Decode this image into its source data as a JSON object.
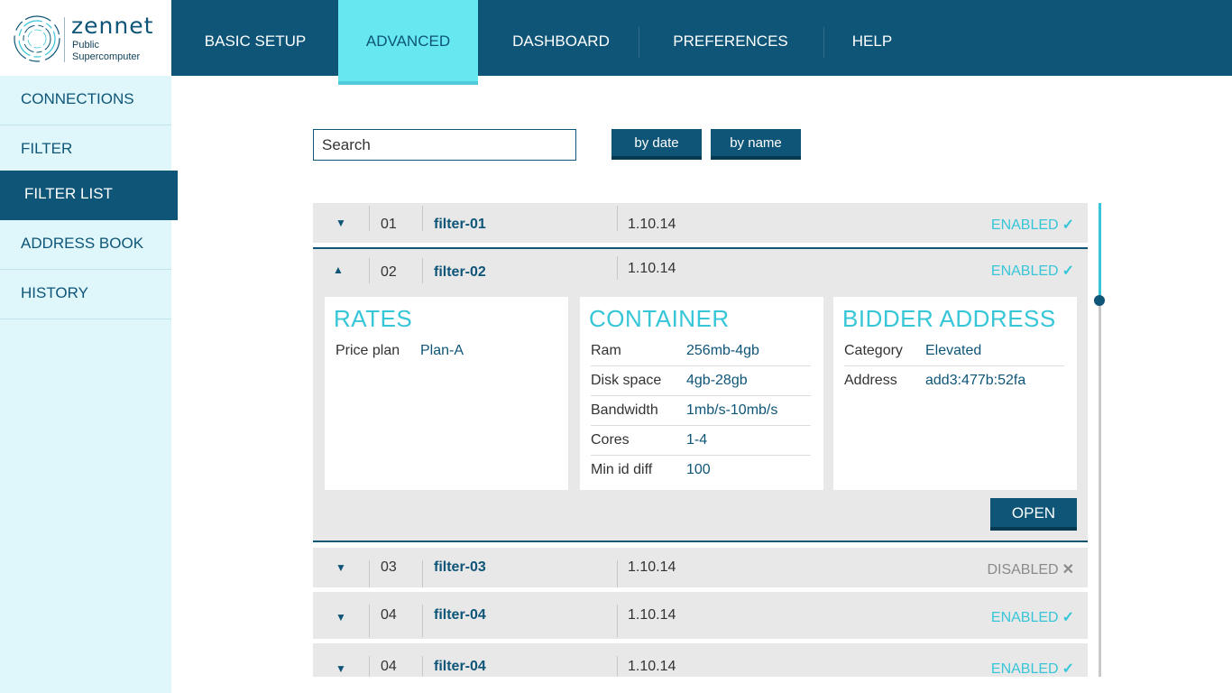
{
  "logo": {
    "brand": "zennet",
    "sub_line1": "Public",
    "sub_line2": "Supercomputer"
  },
  "nav": {
    "tabs": [
      {
        "label": "BASIC SETUP"
      },
      {
        "label": "ADVANCED"
      },
      {
        "label": "DASHBOARD"
      },
      {
        "label": "PREFERENCES"
      },
      {
        "label": "HELP"
      }
    ],
    "active_tab": "ADVANCED"
  },
  "sidebar": {
    "items": [
      {
        "label": "CONNECTIONS"
      },
      {
        "label": "FILTER"
      },
      {
        "label": "FILTER LIST"
      },
      {
        "label": "ADDRESS BOOK"
      },
      {
        "label": "HISTORY"
      }
    ],
    "active_item": "FILTER LIST"
  },
  "search": {
    "placeholder": "Search",
    "value": ""
  },
  "sort": {
    "by_date": "by date",
    "by_name": "by name"
  },
  "filters": [
    {
      "num": "01",
      "name": "filter-01",
      "date": "1.10.14",
      "status": "ENABLED",
      "mark": "✓",
      "expanded": false
    },
    {
      "num": "02",
      "name": "filter-02",
      "date": "1.10.14",
      "status": "ENABLED",
      "mark": "✓",
      "expanded": true
    },
    {
      "num": "03",
      "name": "filter-03",
      "date": "1.10.14",
      "status": "DISABLED",
      "mark": "✕",
      "expanded": false
    },
    {
      "num": "04",
      "name": "filter-04",
      "date": "1.10.14",
      "status": "ENABLED",
      "mark": "✓",
      "expanded": false
    },
    {
      "num": "04",
      "name": "filter-04",
      "date": "1.10.14",
      "status": "ENABLED",
      "mark": "✓",
      "expanded": false
    }
  ],
  "details": {
    "rates": {
      "title": "RATES",
      "rows": [
        {
          "k": "Price plan",
          "v": "Plan-A"
        }
      ]
    },
    "container": {
      "title": "CONTAINER",
      "rows": [
        {
          "k": "Ram",
          "v": "256mb-4gb"
        },
        {
          "k": "Disk space",
          "v": "4gb-28gb"
        },
        {
          "k": "Bandwidth",
          "v": "1mb/s-10mb/s"
        },
        {
          "k": "Cores",
          "v": "1-4"
        },
        {
          "k": "Min id diff",
          "v": "100"
        }
      ]
    },
    "bidder": {
      "title": "BIDDER ADDRESS",
      "rows": [
        {
          "k": "Category",
          "v": "Elevated"
        },
        {
          "k": "Address",
          "v": "add3:477b:52fa"
        }
      ]
    },
    "open_label": "OPEN"
  },
  "colors": {
    "primary": "#0e5577",
    "accent": "#36c6d8",
    "active_tab": "#67e8f0",
    "sidebar_bg": "#dff7fb",
    "row_bg": "#e8e8e8"
  },
  "icons": {
    "expand": "chevron-down-icon",
    "collapse": "chevron-up-icon",
    "enabled": "check-icon",
    "disabled": "close-icon"
  }
}
